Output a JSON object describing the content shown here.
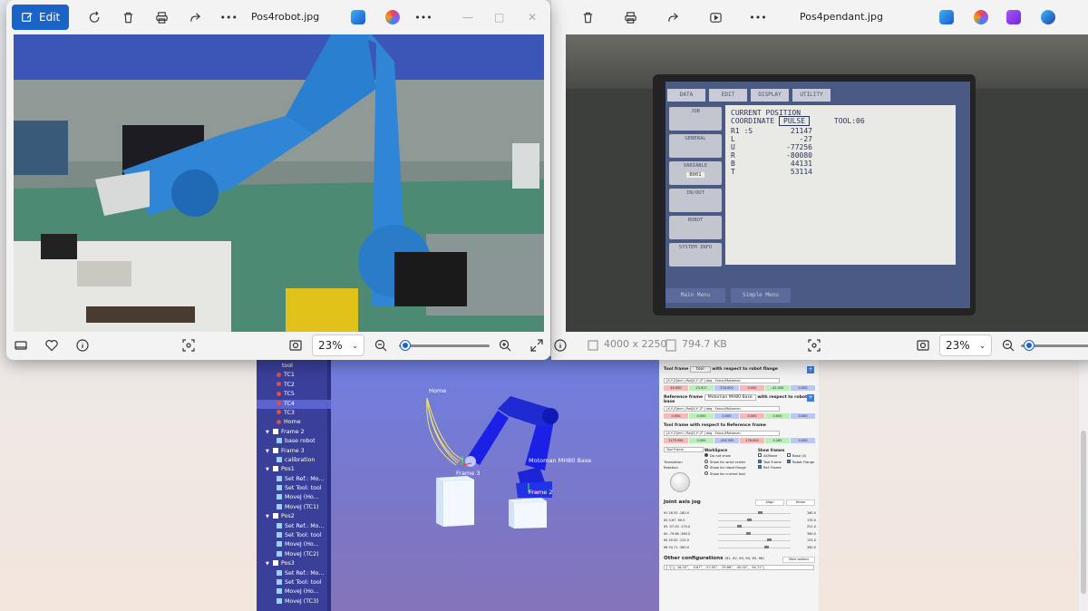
{
  "left_viewer": {
    "edit_label": "Edit",
    "filename": "Pos4robot.jpg",
    "zoom": "23%",
    "zoom_fraction": 0.0
  },
  "right_viewer": {
    "filename": "Pos4pendant.jpg",
    "dimensions": "4000 x 2250",
    "filesize": "794.7 KB",
    "zoom": "23%"
  },
  "pendant_screen": {
    "tabs": [
      "DATA",
      "EDIT",
      "DISPLAY",
      "UTILITY"
    ],
    "line1": "CURRENT POSITION",
    "line2_label": "COORDINATE",
    "line2_value": "PULSE",
    "tool": "TOOL:06",
    "axes": [
      {
        "name": "R1 :S",
        "value": "21147"
      },
      {
        "name": "L",
        "value": "-27"
      },
      {
        "name": "U",
        "value": "-77256"
      },
      {
        "name": "R",
        "value": "-80080"
      },
      {
        "name": "B",
        "value": "44131"
      },
      {
        "name": "T",
        "value": "53114"
      }
    ],
    "menu": [
      "JOB",
      "GENERAL",
      "VARIABLE",
      "IN/OUT",
      "ROBOT",
      "SYSTEM INFO"
    ],
    "variable_tag": "B001",
    "bottom": [
      "Main Menu",
      "Simple Menu"
    ]
  },
  "tree": {
    "items": [
      {
        "label": "tool",
        "indent": 3,
        "type": "plain"
      },
      {
        "label": "TC1",
        "indent": 2,
        "type": "dot"
      },
      {
        "label": "TC2",
        "indent": 2,
        "type": "dot"
      },
      {
        "label": "TC5",
        "indent": 2,
        "type": "dot"
      },
      {
        "label": "TC4",
        "indent": 2,
        "type": "dot",
        "selected": true
      },
      {
        "label": "TC3",
        "indent": 2,
        "type": "dot"
      },
      {
        "label": "Home",
        "indent": 2,
        "type": "dot"
      },
      {
        "label": "Frame 2",
        "indent": 0,
        "type": "fold"
      },
      {
        "label": "base robot",
        "indent": 2,
        "type": "ico"
      },
      {
        "label": "Frame 3",
        "indent": 0,
        "type": "fold"
      },
      {
        "label": "calibration",
        "indent": 2,
        "type": "ico"
      },
      {
        "label": "Pos1",
        "indent": 0,
        "type": "fold"
      },
      {
        "label": "Set Ref.: Mo...",
        "indent": 2,
        "type": "ico"
      },
      {
        "label": "Set Tool: tool",
        "indent": 2,
        "type": "ico"
      },
      {
        "label": "MoveJ (Ho...",
        "indent": 2,
        "type": "ico"
      },
      {
        "label": "MoveJ (TC1)",
        "indent": 2,
        "type": "ico"
      },
      {
        "label": "Pos2",
        "indent": 0,
        "type": "fold"
      },
      {
        "label": "Set Ref.: Mo...",
        "indent": 2,
        "type": "ico"
      },
      {
        "label": "Set Tool: tool",
        "indent": 2,
        "type": "ico"
      },
      {
        "label": "MoveJ (Ho...",
        "indent": 2,
        "type": "ico"
      },
      {
        "label": "MoveJ (TC2)",
        "indent": 2,
        "type": "ico"
      },
      {
        "label": "Pos3",
        "indent": 0,
        "type": "fold"
      },
      {
        "label": "Set Ref.: Mo...",
        "indent": 2,
        "type": "ico"
      },
      {
        "label": "Set Tool: tool",
        "indent": 2,
        "type": "ico"
      },
      {
        "label": "MoveJ (Ho...",
        "indent": 2,
        "type": "ico"
      },
      {
        "label": "MoveJ (TC3)",
        "indent": 2,
        "type": "ico"
      }
    ]
  },
  "scene": {
    "home": "Home",
    "frame3": "Frame 3",
    "base": "Motoman MH80 Base",
    "frame2": "Frame 2"
  },
  "panel": {
    "tool_frame": "Tool frame",
    "tool_sel": "tool",
    "tool_rel": "with respect to robot flange",
    "tool_fmt": "[X,Y,Z]mm | Rot[X,Y',Z''] deg - Fanuc/Motoman",
    "tool_vals": [
      "40.000",
      "23.917",
      "234.000",
      "0.000",
      "-42.000",
      "0.000"
    ],
    "ref_frame": "Reference frame",
    "ref_sel": "Motoman MH80 Base",
    "ref_rel": "with respect to robot base",
    "ref_fmt": "[X,Y,Z]mm | Rot[X,Y',Z''] deg - Fanuc/Motoman",
    "ref_vals": [
      "0.000",
      "0.000",
      "0.000",
      "0.000",
      "0.000",
      "0.000"
    ],
    "tool_ref": "Tool frame with respect to Reference frame",
    "tr_fmt": "[X,Y,Z]mm | Rot[X,Y',Z''] deg - Fanuc/Motoman",
    "tr_vals": [
      "1175.961",
      "0.000",
      "-104.392",
      "178.000",
      "0.262",
      "0.000"
    ],
    "tool_frame_box": "Tool Frame",
    "translation": "Translation",
    "rotation": "Rotation",
    "workspace": "WorkSpace",
    "ws_opts": [
      "Do not show",
      "Show for wrist center",
      "Show for robot flange",
      "Show for current tool"
    ],
    "show_frames": "Show frames",
    "sf_opts": [
      "All/None",
      "Base (0)",
      "Tool Frame",
      "Robot Flange",
      "Ref. Frame"
    ],
    "joint_jog": "Joint axis jog",
    "align": "Align",
    "home_btn": "Home",
    "joints": [
      {
        "name": "θ1",
        "val": "16.33",
        "min": "-180.0",
        "max": "180.0",
        "frac": 0.545
      },
      {
        "name": "θ2",
        "val": "0.67",
        "min": "-90.0",
        "max": "135.0",
        "frac": 0.403
      },
      {
        "name": "θ3",
        "val": "-57.00",
        "min": "-170.0",
        "max": "251.0",
        "frac": 0.268
      },
      {
        "name": "θ4",
        "val": "-79.66",
        "min": "-360.0",
        "max": "360.0",
        "frac": 0.389
      },
      {
        "name": "θ5",
        "val": "45.00",
        "min": "-125.0",
        "max": "125.0",
        "frac": 0.68
      },
      {
        "name": "θ6",
        "val": "94.71",
        "min": "-360.0",
        "max": "360.0",
        "frac": 0.632
      }
    ],
    "other_conf": "Other configurations",
    "other_axes": "(θ1, θ2, θ3, θ4, θ5, θ6)",
    "more_opts": "More options",
    "conf_val": "[ \"j\"-[  16.33°,    0.67°,  -57.00°,  -79.66°,   45.00°,   94.71°]"
  }
}
